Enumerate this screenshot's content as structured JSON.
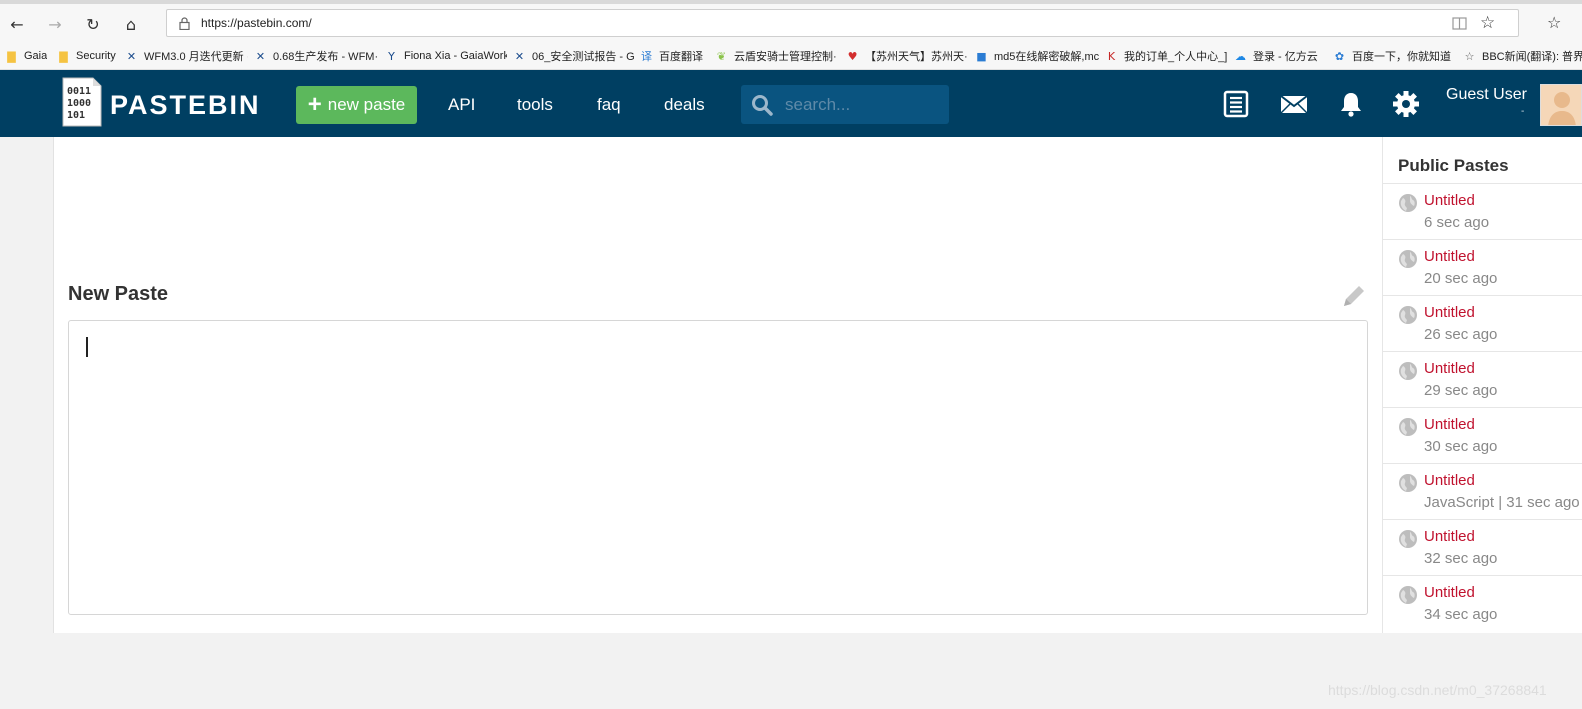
{
  "browser": {
    "url": "https://pastebin.com/",
    "bookmarks": [
      {
        "label": "Gaia",
        "icon": "folder-icon",
        "color": "#f5c342"
      },
      {
        "label": "Security",
        "icon": "folder-icon",
        "color": "#f5c342"
      },
      {
        "label": "WFM3.0 月迭代更新 ·",
        "icon": "tools-icon",
        "color": "#1a4b8c"
      },
      {
        "label": "0.68生产发布 - WFM·",
        "icon": "tools-icon",
        "color": "#1a4b8c"
      },
      {
        "label": "Fiona Xia - GaiaWork",
        "icon": "person-icon",
        "color": "#1a4b8c"
      },
      {
        "label": "06_安全测试报告 - G·",
        "icon": "tools-icon",
        "color": "#1a4b8c"
      },
      {
        "label": "百度翻译",
        "icon": "translate-icon",
        "color": "#2b7cd3"
      },
      {
        "label": "云盾安骑士管理控制·",
        "icon": "leaf-icon",
        "color": "#8bc34a"
      },
      {
        "label": "【苏州天气】苏州天·",
        "icon": "heart-icon",
        "color": "#d32f2f"
      },
      {
        "label": "md5在线解密破解,mc",
        "icon": "square-icon",
        "color": "#2b7cd3"
      },
      {
        "label": "我的订单_个人中心_]",
        "icon": "k-icon",
        "color": "#c62828"
      },
      {
        "label": "登录 - 亿方云",
        "icon": "cloud-icon",
        "color": "#1e88e5"
      },
      {
        "label": "百度一下，你就知道",
        "icon": "paw-icon",
        "color": "#2b7cd3"
      },
      {
        "label": "BBC新闻(翻译): 普界",
        "icon": "star-icon",
        "color": "#555555"
      }
    ]
  },
  "header": {
    "logo_text": "PASTEBIN",
    "new_paste_label": "new paste",
    "nav": [
      "API",
      "tools",
      "faq",
      "deals"
    ],
    "search_placeholder": "search...",
    "user_name": "Guest User",
    "user_sub": "-",
    "colors": {
      "bar": "#003f62",
      "button": "#5cb85c",
      "search": "#0a5480"
    }
  },
  "main": {
    "title": "New Paste",
    "editor_value": ""
  },
  "sidebar": {
    "title": "Public Pastes",
    "items": [
      {
        "title": "Untitled",
        "meta": "6 sec ago"
      },
      {
        "title": "Untitled",
        "meta": "20 sec ago"
      },
      {
        "title": "Untitled",
        "meta": "26 sec ago"
      },
      {
        "title": "Untitled",
        "meta": "29 sec ago"
      },
      {
        "title": "Untitled",
        "meta": "30 sec ago"
      },
      {
        "title": "Untitled",
        "meta": "JavaScript | 31 sec ago"
      },
      {
        "title": "Untitled",
        "meta": "32 sec ago"
      },
      {
        "title": "Untitled",
        "meta": "34 sec ago"
      }
    ]
  },
  "watermark": "https://blog.csdn.net/m0_37268841"
}
